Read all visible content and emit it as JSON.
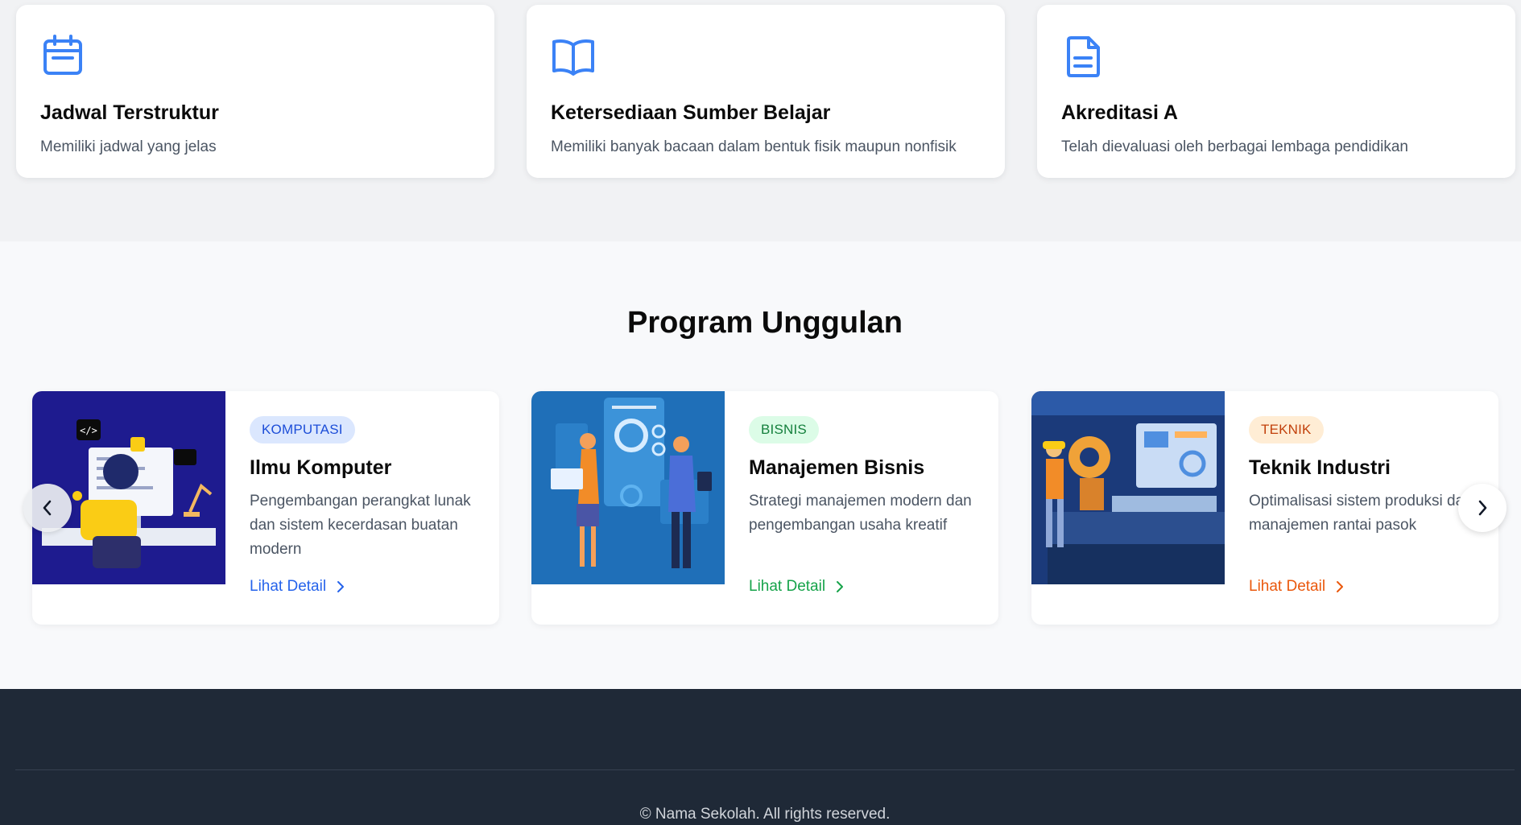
{
  "features": [
    {
      "icon": "calendar-icon",
      "title": "Jadwal Terstruktur",
      "description": "Memiliki jadwal yang jelas"
    },
    {
      "icon": "book-open-icon",
      "title": "Ketersediaan Sumber Belajar",
      "description": "Memiliki banyak bacaan dalam bentuk fisik maupun nonfisik"
    },
    {
      "icon": "document-icon",
      "title": "Akreditasi A",
      "description": "Telah dievaluasi oleh berbagai lembaga pendidikan"
    }
  ],
  "programs": {
    "title": "Program Unggulan",
    "items": [
      {
        "category": "KOMPUTASI",
        "title": "Ilmu Komputer",
        "description": "Pengembangan perangkat lunak dan sistem kecerdasan buatan modern",
        "link": "Lihat Detail",
        "accent": "#2563eb"
      },
      {
        "category": "BISNIS",
        "title": "Manajemen Bisnis",
        "description": "Strategi manajemen modern dan pengembangan usaha kreatif",
        "link": "Lihat Detail",
        "accent": "#16a34a"
      },
      {
        "category": "TEKNIK",
        "title": "Teknik Industri",
        "description": "Optimalisasi sistem produksi dan manajemen rantai pasok",
        "link": "Lihat Detail",
        "accent": "#ea580c"
      }
    ],
    "prev_icon": "chevron-left-icon",
    "next_icon": "chevron-right-icon"
  },
  "footer": {
    "copyright": "© Nama Sekolah. All rights reserved."
  },
  "colors": {
    "primary_icon": "#3b82f6",
    "footer_bg": "#1f2937"
  }
}
